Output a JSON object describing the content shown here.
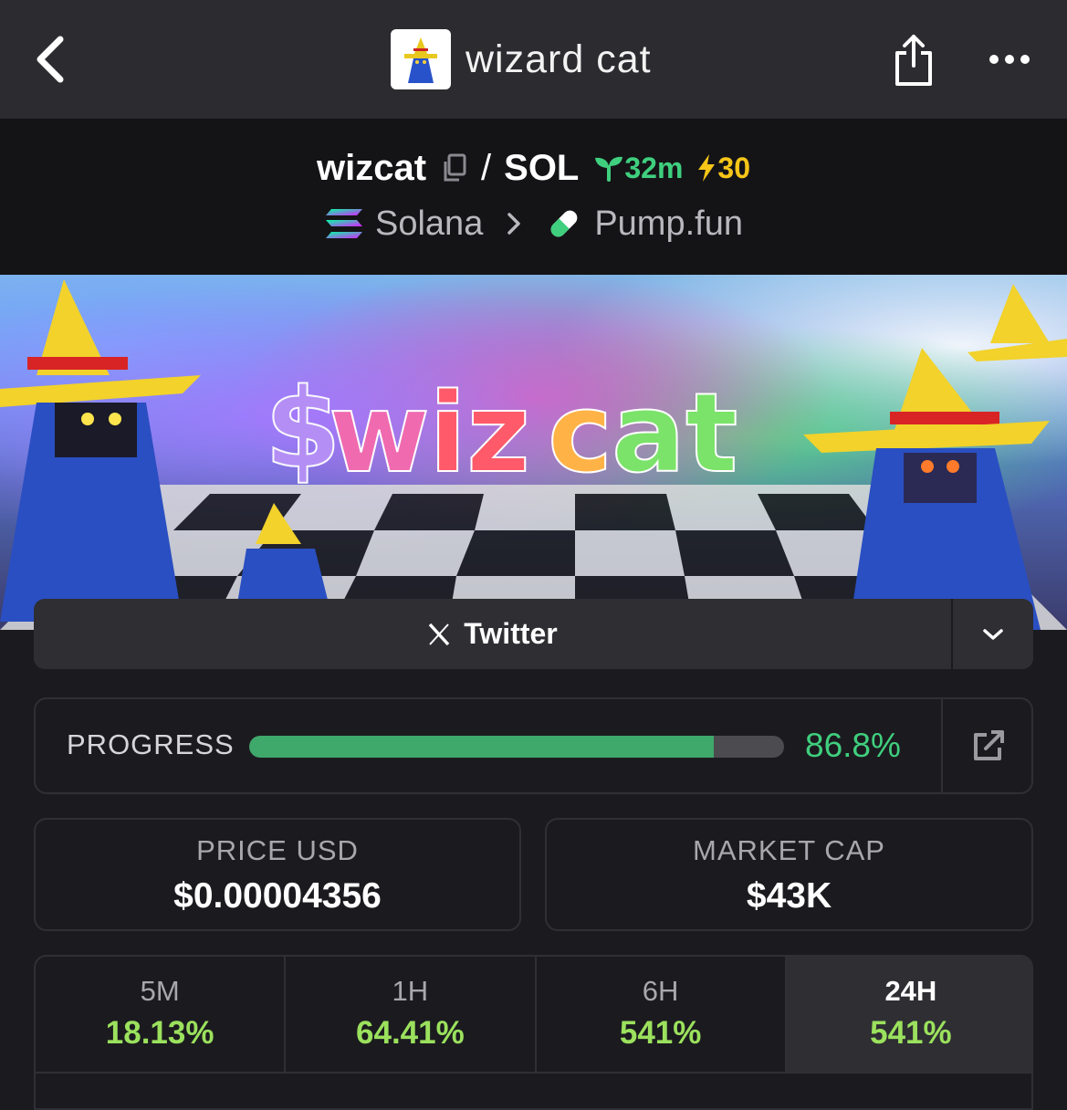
{
  "topbar": {
    "title": "wizard cat",
    "back_icon": "chevron-left-icon",
    "share_icon": "share-icon",
    "more_icon": "more-horizontal-icon"
  },
  "pair": {
    "base": "wizcat",
    "separator": "/",
    "quote": "SOL",
    "age": "32m",
    "boosts": "30",
    "chain": "Solana",
    "dex": "Pump.fun"
  },
  "social": {
    "label": "Twitter"
  },
  "progress": {
    "label": "PROGRESS",
    "value_text": "86.8%",
    "value": 86.8
  },
  "stats": {
    "price_label": "PRICE USD",
    "price_value": "$0.00004356",
    "mcap_label": "MARKET CAP",
    "mcap_value": "$43K"
  },
  "timeframes": [
    {
      "label": "5M",
      "change": "18.13%"
    },
    {
      "label": "1H",
      "change": "64.41%"
    },
    {
      "label": "6H",
      "change": "541%"
    },
    {
      "label": "24H",
      "change": "541%",
      "active": true
    }
  ],
  "colors": {
    "accent_green": "#3fcf7e",
    "change_green": "#9be15d",
    "boost_yellow": "#f5c518",
    "background": "#1b1b1f"
  }
}
